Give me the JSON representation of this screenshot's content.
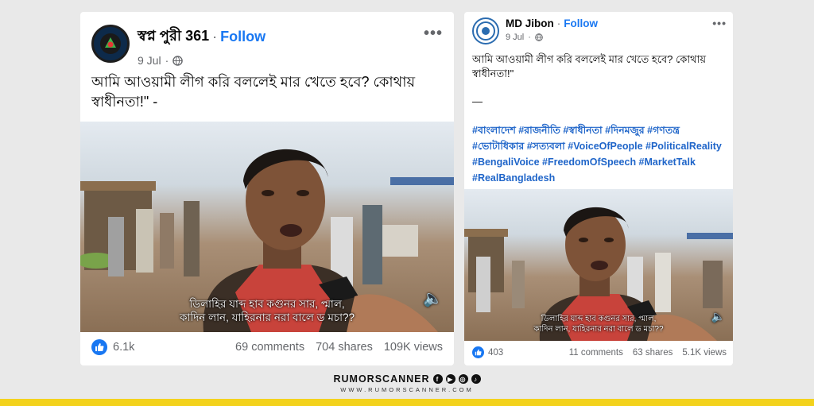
{
  "posts": [
    {
      "author": "স্বপ্ন পুরী 361",
      "follow_label": "Follow",
      "date": "9 Jul",
      "text": "আমি আওয়ামী লীগ করি বললেই মার খেতে হবে? কোথায় স্বাধীনতা!\" -",
      "subtitle_line1": "ডিলাহির যাব্দ হাব কগুনর সার, প্মাল,",
      "subtitle_line2": "কাদিন লান, যাহিরনার নরা বালে ড মচা??",
      "likes": "6.1k",
      "comments": "69 comments",
      "shares": "704 shares",
      "views": "109K views"
    },
    {
      "author": "MD Jibon",
      "follow_label": "Follow",
      "date": "9 Jul",
      "text": "আমি আওয়ামী লীগ করি বললেই মার খেতে হবে? কোথায় স্বাধীনতা!\"",
      "separator": "—",
      "hashtags": "#বাংলাদেশ #রাজনীতি #স্বাধীনতা #দিনমজুর #গণতন্ত্র #ভোটাধিকার #সত্যবলা #VoiceOfPeople #PoliticalReality #BengaliVoice #FreedomOfSpeech #MarketTalk #RealBangladesh",
      "subtitle_line1": "ডিলাহির যাব্দ হাব কগুনর সার, প্মাল,",
      "subtitle_line2": "কাদিন লান, যাহিরনার নরা বালে ড মচা??",
      "likes": "403",
      "comments": "11 comments",
      "shares": "63 shares",
      "views": "5.1K views"
    }
  ],
  "brand": {
    "name": "RUMORSCANNER",
    "url": "WWW.RUMORSCANNER.COM"
  },
  "colors": {
    "facebook_blue": "#1877f2",
    "hashtag_blue": "#1f65c9",
    "brand_bar": "#f3d21c"
  },
  "icons": [
    "globe-icon",
    "more-options-icon",
    "like-icon",
    "volume-icon",
    "facebook-icon",
    "youtube-icon",
    "instagram-icon",
    "tiktok-icon"
  ]
}
